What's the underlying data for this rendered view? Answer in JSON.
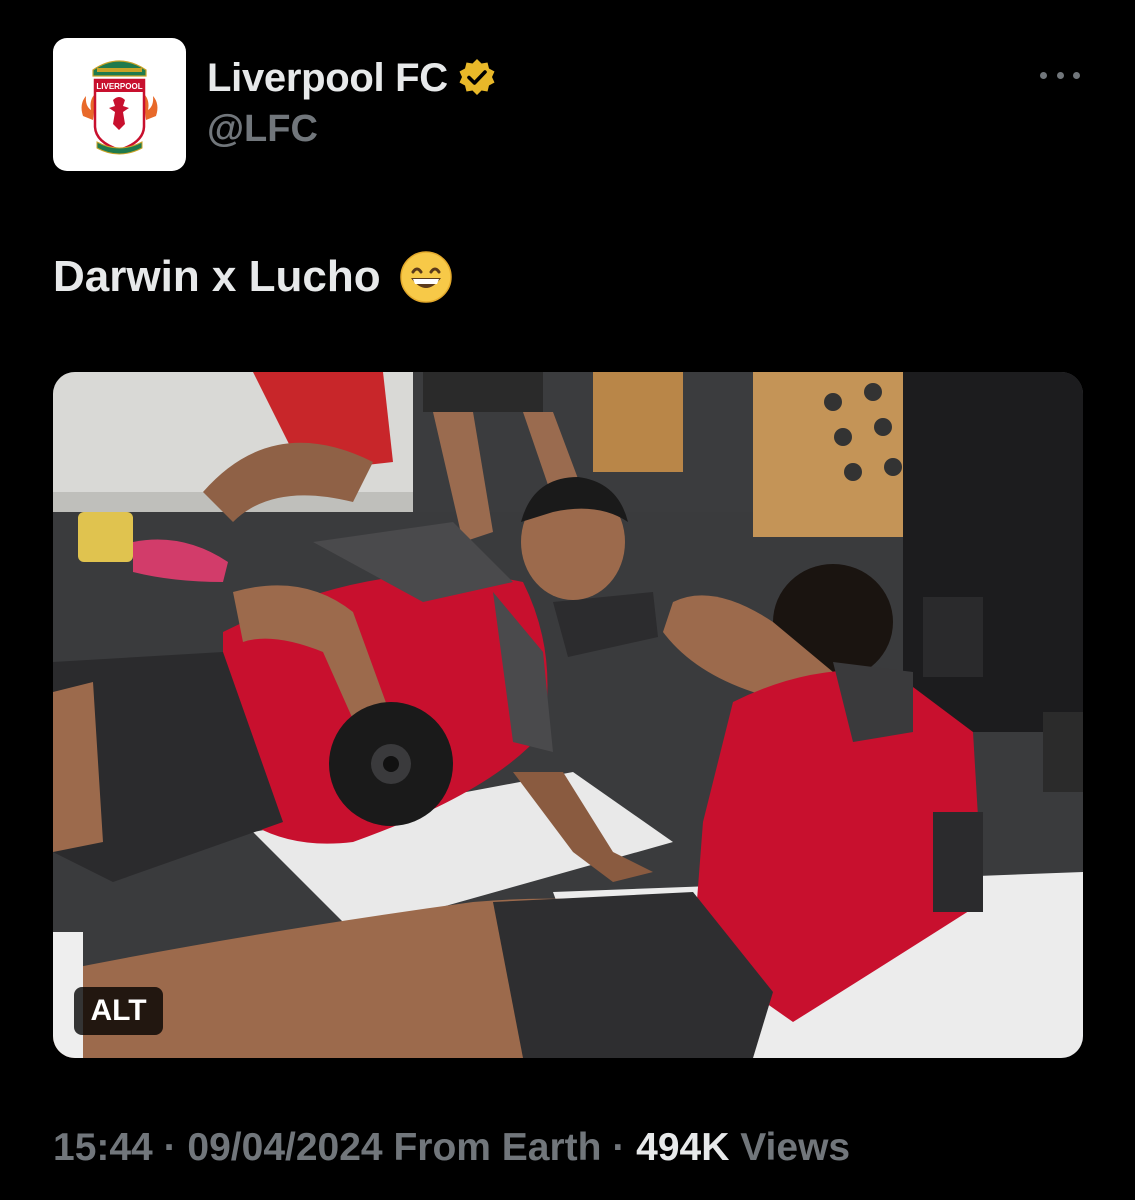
{
  "author": {
    "display_name": "Liverpool FC",
    "handle": "@LFC",
    "verified_badge_icon": "gold-verified-badge-icon",
    "avatar_icon": "liverpool-crest-icon",
    "avatar_logo_text": "LIVERPOOL"
  },
  "more_menu_icon": "more-horizontal-icon",
  "tweet": {
    "text": "Darwin x Lucho",
    "emoji_icon": "grinning-face-emoji-icon"
  },
  "media": {
    "alt_label": "ALT"
  },
  "meta": {
    "time": "15:44",
    "separator1": " · ",
    "date": "09/04/2024",
    "source": " From Earth",
    "separator2": " · ",
    "views_count": "494K",
    "views_label": " Views"
  },
  "colors": {
    "background": "#000000",
    "primary_text": "#e7e9ea",
    "secondary_text": "#71767b",
    "verified_gold": "#e8b829",
    "lfc_red": "#c8102e"
  }
}
